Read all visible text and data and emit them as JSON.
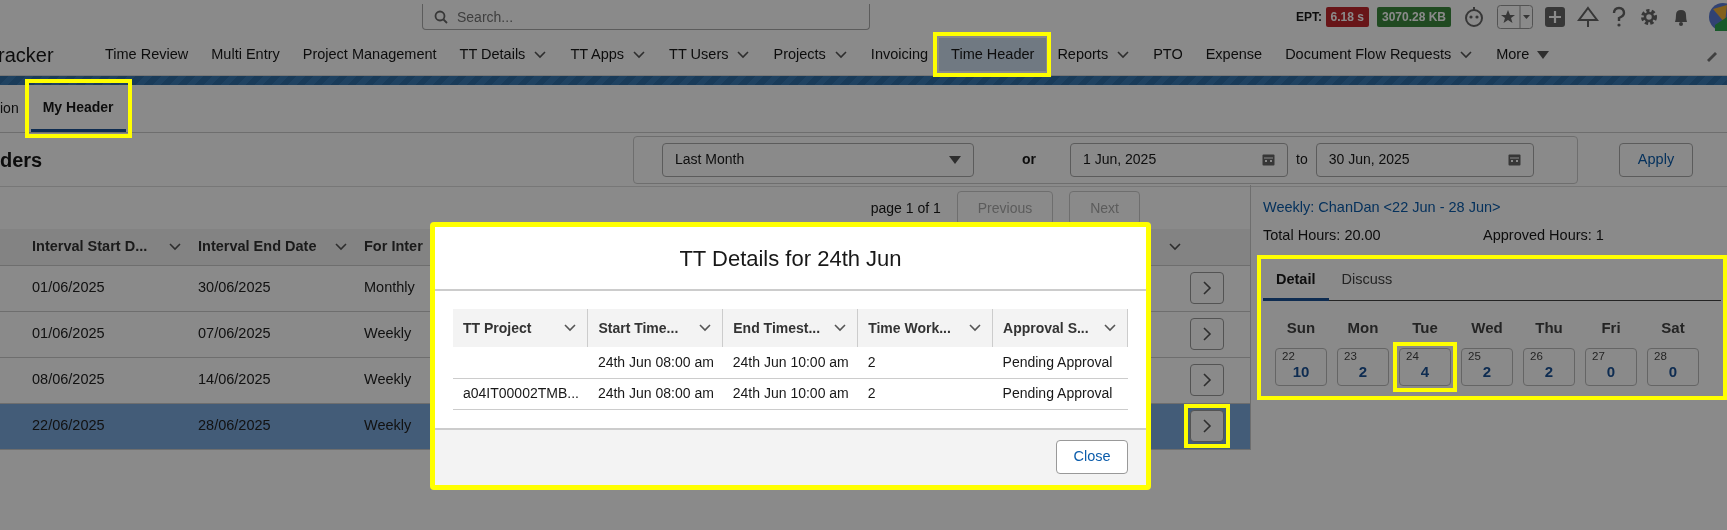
{
  "search": {
    "placeholder": "Search..."
  },
  "perf": {
    "label": "EPT:",
    "time": "6.18 s",
    "memory": "3070.28 KB"
  },
  "app_name": "racker",
  "nav": {
    "items": [
      {
        "label": "Time Review",
        "kind": "link",
        "selected": false,
        "highlighted": false
      },
      {
        "label": "Multi Entry",
        "kind": "link",
        "selected": false,
        "highlighted": false
      },
      {
        "label": "Project Management",
        "kind": "link",
        "selected": false,
        "highlighted": false
      },
      {
        "label": "TT Details",
        "kind": "dropdown",
        "selected": false,
        "highlighted": false
      },
      {
        "label": "TT Apps",
        "kind": "dropdown",
        "selected": false,
        "highlighted": false
      },
      {
        "label": "TT Users",
        "kind": "dropdown",
        "selected": false,
        "highlighted": false
      },
      {
        "label": "Projects",
        "kind": "dropdown",
        "selected": false,
        "highlighted": false
      },
      {
        "label": "Invoicing",
        "kind": "link",
        "selected": false,
        "highlighted": false
      },
      {
        "label": "Time Header",
        "kind": "link",
        "selected": true,
        "highlighted": true
      },
      {
        "label": "Reports",
        "kind": "dropdown",
        "selected": false,
        "highlighted": false
      },
      {
        "label": "PTO",
        "kind": "link",
        "selected": false,
        "highlighted": false
      },
      {
        "label": "Expense",
        "kind": "link",
        "selected": false,
        "highlighted": false
      },
      {
        "label": "Document Flow Requests",
        "kind": "dropdown",
        "selected": false,
        "highlighted": false
      },
      {
        "label": "More",
        "kind": "more",
        "selected": false,
        "highlighted": false
      }
    ]
  },
  "subtabs": [
    {
      "label": "ion",
      "selected": false,
      "highlighted": false
    },
    {
      "label": "My Header",
      "selected": true,
      "highlighted": true
    }
  ],
  "page_title": "ders",
  "filter": {
    "range": "Last Month",
    "or_label": "or",
    "from": "1 Jun, 2025",
    "to_label": "to",
    "to": "30 Jun, 2025",
    "apply": "Apply"
  },
  "pagination": {
    "text": "page 1 of 1",
    "previous": {
      "label": "Previous",
      "disabled": true
    },
    "next": {
      "label": "Next",
      "disabled": true
    }
  },
  "table": {
    "columns": [
      "Interval Start D...",
      "Interval End Date",
      "For Inter"
    ],
    "rows": [
      {
        "cells": [
          "01/06/2025",
          "30/06/2025",
          "Monthly"
        ],
        "selected": false,
        "highlighted": false
      },
      {
        "cells": [
          "01/06/2025",
          "07/06/2025",
          "Weekly"
        ],
        "selected": false,
        "highlighted": false
      },
      {
        "cells": [
          "08/06/2025",
          "14/06/2025",
          "Weekly"
        ],
        "selected": false,
        "highlighted": false
      },
      {
        "cells": [
          "22/06/2025",
          "28/06/2025",
          "Weekly"
        ],
        "selected": true,
        "highlighted": true
      }
    ]
  },
  "detail": {
    "title": "Weekly: ChanDan <22 Jun - 28 Jun>",
    "total": "Total Hours: 20.00",
    "approved": "Approved Hours: 1",
    "highlighted": true,
    "tabs": [
      {
        "label": "Detail",
        "selected": true
      },
      {
        "label": "Discuss",
        "selected": false
      }
    ],
    "days": [
      {
        "day": "Sun",
        "date": "22",
        "hours": "10",
        "highlighted": false
      },
      {
        "day": "Mon",
        "date": "23",
        "hours": "2",
        "highlighted": false
      },
      {
        "day": "Tue",
        "date": "24",
        "hours": "4",
        "highlighted": true
      },
      {
        "day": "Wed",
        "date": "25",
        "hours": "2",
        "highlighted": false
      },
      {
        "day": "Thu",
        "date": "26",
        "hours": "2",
        "highlighted": false
      },
      {
        "day": "Fri",
        "date": "27",
        "hours": "0",
        "highlighted": false
      },
      {
        "day": "Sat",
        "date": "28",
        "hours": "0",
        "highlighted": false
      }
    ]
  },
  "modal": {
    "title": "TT Details for 24th Jun",
    "highlighted": true,
    "columns": [
      "TT Project",
      "Start Time...",
      "End Timest...",
      "Time Work...",
      "Approval S..."
    ],
    "rows": [
      {
        "cells": [
          "",
          "24th Jun 08:00 am",
          "24th Jun 10:00 am",
          "2",
          "Pending Approval"
        ]
      },
      {
        "cells": [
          "a04IT00002TMB...",
          "24th Jun 08:00 am",
          "24th Jun 10:00 am",
          "2",
          "Pending Approval"
        ]
      }
    ],
    "close": "Close"
  }
}
